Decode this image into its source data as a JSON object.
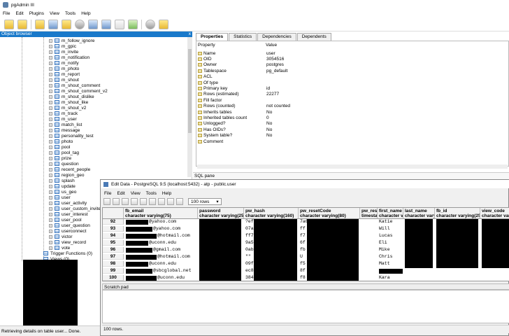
{
  "app": {
    "title": "pgAdmin III"
  },
  "menu": [
    "File",
    "Edit",
    "Plugins",
    "View",
    "Tools",
    "Help"
  ],
  "object_browser": {
    "title": "Object browser",
    "close": "x",
    "tables": [
      "m_follow_ignore",
      "m_gpic",
      "m_invite",
      "m_notification",
      "m_notify",
      "m_photo",
      "m_report",
      "m_shout",
      "m_shout_comment",
      "m_shout_comment_v2",
      "m_shout_dislike",
      "m_shout_like",
      "m_shout_v2",
      "m_track",
      "m_user",
      "match_list",
      "message",
      "personality_test",
      "photo",
      "pool",
      "pool_tag",
      "prize",
      "question",
      "recent_people",
      "region_geo",
      "splash",
      "update",
      "us_geo",
      "user",
      "user_activity",
      "user_custom_invite",
      "user_interest",
      "user_pool",
      "user_question",
      "userconnect",
      "victor",
      "view_record",
      "vote"
    ],
    "trigger_functions": "Trigger Functions (0)",
    "views": "Views (0)"
  },
  "properties": {
    "tabs": [
      "Properties",
      "Statistics",
      "Dependencies",
      "Dependents"
    ],
    "header": {
      "property": "Property",
      "value": "Value"
    },
    "rows": [
      {
        "k": "Name",
        "v": "user"
      },
      {
        "k": "OID",
        "v": "3054516"
      },
      {
        "k": "Owner",
        "v": "postgres"
      },
      {
        "k": "Tablespace",
        "v": "pg_default"
      },
      {
        "k": "ACL",
        "v": ""
      },
      {
        "k": "Of type",
        "v": ""
      },
      {
        "k": "Primary key",
        "v": "id"
      },
      {
        "k": "Rows (estimated)",
        "v": "22277"
      },
      {
        "k": "Fill factor",
        "v": ""
      },
      {
        "k": "Rows (counted)",
        "v": "not counted"
      },
      {
        "k": "Inherits tables",
        "v": "No"
      },
      {
        "k": "Inherited tables count",
        "v": "0"
      },
      {
        "k": "Unlogged?",
        "v": "No"
      },
      {
        "k": "Has OIDs?",
        "v": "No"
      },
      {
        "k": "System table?",
        "v": "No"
      },
      {
        "k": "Comment",
        "v": ""
      }
    ],
    "sql_pane": "SQL pane"
  },
  "edit_data": {
    "title": "Edit Data - PostgreSQL 9.5 (localhost:5432) - atp - public.user",
    "menu": [
      "File",
      "Edit",
      "View",
      "Tools",
      "Help"
    ],
    "rows_limit": "100 rows",
    "columns": [
      {
        "name": "fb_email",
        "type": "character varying(75)"
      },
      {
        "name": "password",
        "type": "character varying(25)"
      },
      {
        "name": "pw_hash",
        "type": "character varying(160)"
      },
      {
        "name": "pw_resetCode",
        "type": "character varying(80)"
      },
      {
        "name": "pw_rese",
        "type": "timesta"
      },
      {
        "name": "first_name",
        "type": "character va"
      },
      {
        "name": "last_name",
        "type": "character vary"
      },
      {
        "name": "fb_id",
        "type": "character varying(25)"
      },
      {
        "name": "view_code",
        "type": "character varyi"
      }
    ],
    "rows": [
      {
        "n": "92",
        "email": "@yahoo.com",
        "hash": "?ef",
        "reset": "7a6",
        "first": "Katie"
      },
      {
        "n": "93",
        "email": "@yahoo.com",
        "hash": "07a",
        "reset": "ff",
        "first": "Will"
      },
      {
        "n": "94",
        "email": "@hotmail.com",
        "hash": "ff7",
        "reset": "f7",
        "first": "Lucas"
      },
      {
        "n": "95",
        "email": "@uconn.edu",
        "hash": "9a5",
        "reset": "6f",
        "first": "Eli"
      },
      {
        "n": "96",
        "email": "@gmail.com",
        "hash": "0ab",
        "reset": "fb",
        "first": "Mike"
      },
      {
        "n": "97",
        "email": "@hotmail.com",
        "hash": "\"\"",
        "reset": "U",
        "first": "Chris"
      },
      {
        "n": "98",
        "email": "@uconn.edu",
        "hash": "09f",
        "reset": "f5",
        "first": "Matt"
      },
      {
        "n": "99",
        "email": "@sbcglobal.net",
        "hash": "ec8",
        "reset": "8f",
        "first": ""
      },
      {
        "n": "100",
        "email": "@uconn.edu",
        "hash": "384",
        "reset": "f8",
        "first": "Kara"
      }
    ],
    "scratch_pad": "Scratch pad",
    "status": "100 rows."
  },
  "status_bar": "Retrieving details on table user... Done."
}
